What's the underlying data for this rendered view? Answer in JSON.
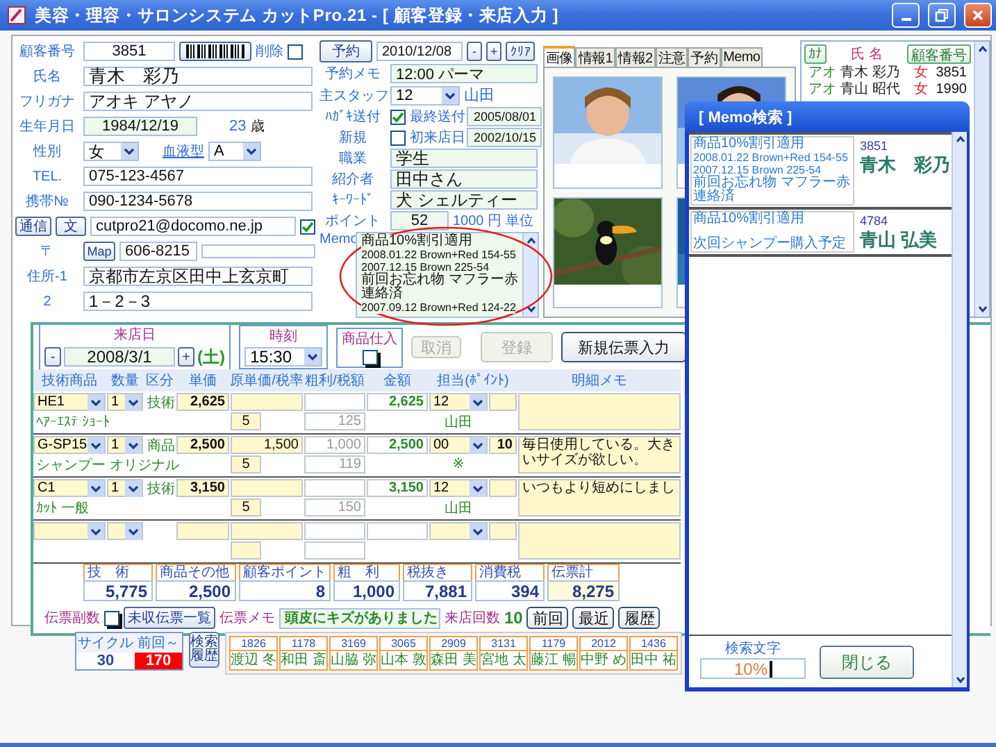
{
  "window": {
    "title": "美容・理容・サロンシステム カットPro.21 - [ 顧客登録・来店入力 ]"
  },
  "customer": {
    "number_label": "顧客番号",
    "number": "3851",
    "delete_label": "削除",
    "deleted": false,
    "name_label": "氏名",
    "name": "青木　彩乃",
    "kana_label": "フリガナ",
    "kana": "アオキ アヤノ",
    "birth_label": "生年月日",
    "birth": "1984/12/19",
    "age": "23",
    "age_unit": "歳",
    "sex_label": "性別",
    "sex": "女",
    "blood_label": "血液型",
    "blood": "A",
    "tel_label": "TEL.",
    "tel": "075-123-4567",
    "mobile_label": "携帯№",
    "mobile": "090-1234-5678",
    "mail_buttons": [
      "通信",
      "文"
    ],
    "email": "cutpro21@docomo.ne.jp",
    "mail_ok": true,
    "zip_label": "〒",
    "map_button": "Map",
    "zip": "606-8215",
    "address1_label": "住所-1",
    "address1": "京都市左京区田中上玄京町",
    "address2_label": "2",
    "address2": "1－2－3"
  },
  "profile": {
    "reserve_button": "予約",
    "reserve_date": "2010/12/08",
    "date_buttons": [
      "-",
      "+",
      "ｸﾘｱ"
    ],
    "reserve_memo_label": "予約メモ",
    "reserve_memo": "12:00 パーマ",
    "staff_label": "主スタッフ",
    "staff": "12",
    "staff_name": "山田",
    "postcard_label": "ﾊｶﾞｷ送付",
    "postcard": true,
    "last_sent_label": "最終送付",
    "last_sent": "2005/08/01",
    "new_label": "新規",
    "new": false,
    "first_visit_label": "初来店日",
    "first_visit": "2002/10/15",
    "job_label": "職業",
    "job": "学生",
    "referrer_label": "紹介者",
    "referrer": "田中さん",
    "keyword_label": "ｷｰﾜｰﾄﾞ",
    "keyword": "犬 シェルティー",
    "point_label": "ポイント",
    "point": "52",
    "point_unit": "1000 円 単位",
    "memo_label": "Memo",
    "memo_lines": [
      {
        "kind": "note",
        "text": "商品10%割引適用"
      },
      {
        "kind": "log",
        "text": "2008.01.22 Brown+Red 154-55"
      },
      {
        "kind": "log",
        "text": "2007.12.15 Brown 225-54"
      },
      {
        "kind": "note",
        "text": "前回お忘れ物 マフラー赤連絡済"
      },
      {
        "kind": "log",
        "text": "2007.09.12 Brown+Red 124-22"
      }
    ]
  },
  "photo_tabs": {
    "tabs": [
      {
        "label": "画像",
        "selected": true
      },
      {
        "label": "情報1",
        "selected": false
      },
      {
        "label": "情報2",
        "selected": false
      },
      {
        "label": "注意",
        "selected": false
      },
      {
        "label": "予約",
        "selected": false
      },
      {
        "label": "Memo",
        "selected": false
      }
    ]
  },
  "customer_list": {
    "columns": [
      "ｶﾅ",
      "氏 名",
      "顧客番号"
    ],
    "rows": [
      {
        "kana": "アオ",
        "name": "青木 彩乃",
        "sex": "女",
        "number": "3851"
      },
      {
        "kana": "アオ",
        "name": "青山 昭代",
        "sex": "女",
        "number": "1990"
      }
    ]
  },
  "slip": {
    "date_label": "来店日",
    "date": "2008/3/1",
    "date_buttons": [
      "-",
      "+"
    ],
    "weekday": "(土)",
    "time_label": "時刻",
    "time": "15:30",
    "stock_label": "商品仕入",
    "stock": false,
    "buttons": [
      {
        "label": "取消",
        "disabled": true
      },
      {
        "label": "登録",
        "disabled": true
      },
      {
        "label": "新規伝票入力",
        "disabled": false
      }
    ],
    "columns": [
      "技術商品",
      "数量",
      "区分",
      "単価",
      "原単価/税率",
      "粗利/税額",
      "金額",
      "担当(ﾎﾟｲﾝﾄ)",
      "明細メモ"
    ],
    "rows": [
      {
        "kind": "item",
        "code": "HE1",
        "qty": "1",
        "category": "技術",
        "price": "2,625",
        "amount": "2,625",
        "staff": "12",
        "item_name": "ﾍｱｰｴｽﾃ ｼｮｰﾄ",
        "tax_rate": "5",
        "tax": "125",
        "staff_name": "山田"
      },
      {
        "kind": "item",
        "code": "G-SP15",
        "qty": "1",
        "category": "商品",
        "price": "2,500",
        "cost": "1,500",
        "profit": "1,000",
        "amount": "2,500",
        "staff": "00",
        "points": "10",
        "memo": "毎日使用している。大きいサイズが欲しい。",
        "item_name": "シャンプー オリジナル",
        "tax_rate": "5",
        "tax": "119",
        "staff_name": "※"
      },
      {
        "kind": "item",
        "code": "C1",
        "qty": "1",
        "category": "技術",
        "price": "3,150",
        "amount": "3,150",
        "staff": "12",
        "memo": "いつもより短めにしまし",
        "item_name": "ｶｯﾄ 一般",
        "tax_rate": "5",
        "tax": "150",
        "staff_name": "山田"
      },
      {
        "kind": "blank"
      }
    ],
    "totals": [
      {
        "label": "技　術",
        "value": "5,775"
      },
      {
        "label": "商品その他",
        "value": "2,500"
      },
      {
        "label": "顧客ポイント",
        "value": "8"
      },
      {
        "label": "粗　利",
        "value": "1,000"
      },
      {
        "label": "税抜き",
        "value": "7,881"
      },
      {
        "label": "消費税",
        "value": "394"
      },
      {
        "label": "伝票計",
        "value": "8,275"
      }
    ],
    "copy_label": "伝票副数",
    "copy": false,
    "unpaid_button": "未収伝票一覧",
    "memo_label": "伝票メモ",
    "memo": "頭皮にキズがありました",
    "visits_label": "来店回数",
    "visits": "10",
    "nav_buttons": [
      "前回",
      "最近",
      "履歴"
    ]
  },
  "footer": {
    "cycle_label": "サイクル",
    "cycle": "30",
    "last_label": "前回～",
    "last": "170",
    "history_button": "検索履歴",
    "recent": [
      {
        "number": "1826",
        "name": "渡辺 冬"
      },
      {
        "number": "1178",
        "name": "和田 斎"
      },
      {
        "number": "3169",
        "name": "山脇 弥"
      },
      {
        "number": "3065",
        "name": "山本 敦"
      },
      {
        "number": "2909",
        "name": "森田 美"
      },
      {
        "number": "3131",
        "name": "宮地 太"
      },
      {
        "number": "1179",
        "name": "藤江 暢"
      },
      {
        "number": "2012",
        "name": "中野 め"
      },
      {
        "number": "1436",
        "name": "田中 祐"
      }
    ]
  },
  "memo_search": {
    "title": "[ Memo検索 ]",
    "results": [
      {
        "lines": [
          {
            "kind": "note",
            "text": "商品10%割引適用"
          },
          {
            "kind": "log",
            "text": "2008.01.22 Brown+Red 154-55"
          },
          {
            "kind": "log",
            "text": "2007.12.15 Brown 225-54"
          },
          {
            "kind": "note",
            "text": "前回お忘れ物 マフラー赤連絡済"
          }
        ],
        "number": "3851",
        "name": "青木　彩乃"
      },
      {
        "lines": [
          {
            "kind": "note",
            "text": "商品10%割引適用"
          },
          {
            "kind": "note",
            "text": "次回シャンプー購入予定"
          }
        ],
        "number": "4784",
        "name": "青山 弘美"
      }
    ],
    "search_label": "検索文字",
    "search": "10%",
    "close_button": "閉じる"
  }
}
